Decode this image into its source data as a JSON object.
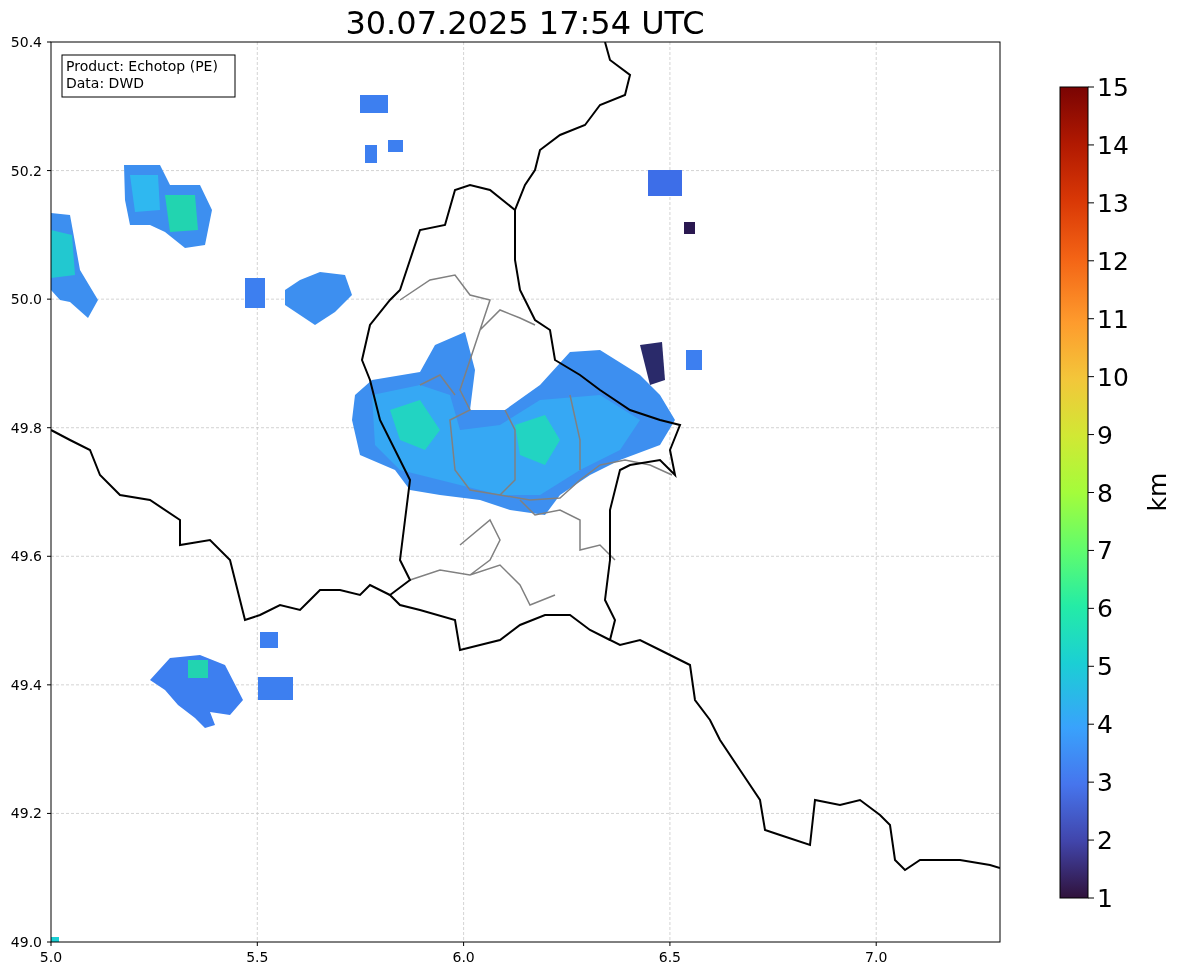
{
  "title": "30.07.2025 17:54 UTC",
  "info_box": [
    "Product: Echotop (PE)",
    "Data: DWD"
  ],
  "map": {
    "x_tick_labels": [
      "5.0",
      "5.5",
      "6.0",
      "6.5",
      "7.0"
    ],
    "y_tick_labels": [
      "50.4",
      "50.2",
      "50.0",
      "49.8",
      "49.6",
      "49.4",
      "49.2",
      "49.0"
    ]
  },
  "colorbar": {
    "label": "km",
    "tick_labels": [
      "15",
      "14",
      "13",
      "12",
      "11",
      "10",
      "9",
      "8",
      "7",
      "6",
      "5",
      "4",
      "3",
      "2",
      "1"
    ]
  }
}
